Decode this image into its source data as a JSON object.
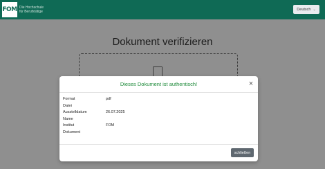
{
  "header": {
    "logo": "FOM",
    "tagline_line1": "Die Hochschule",
    "tagline_line2": "für Berufstätige",
    "language": "Deutsch"
  },
  "page": {
    "title": "Dokument verifizieren"
  },
  "modal": {
    "title": "Dieses Dokument ist authentisch!",
    "close_symbol": "×",
    "fields": [
      {
        "label": "Format",
        "value": "pdf"
      },
      {
        "label": "Datei",
        "value": ""
      },
      {
        "label": "Ausstelldatum",
        "value": "26.07.2025"
      },
      {
        "label": "Name",
        "value": ""
      },
      {
        "label": "Institut",
        "value": "FOM"
      },
      {
        "label": "Dokument",
        "value": ""
      }
    ],
    "action_label": "schließen"
  },
  "colors": {
    "brand": "#0f6a55",
    "success": "#1e8a3a",
    "overlay": "#8f8f8f",
    "button": "#5f6870"
  }
}
